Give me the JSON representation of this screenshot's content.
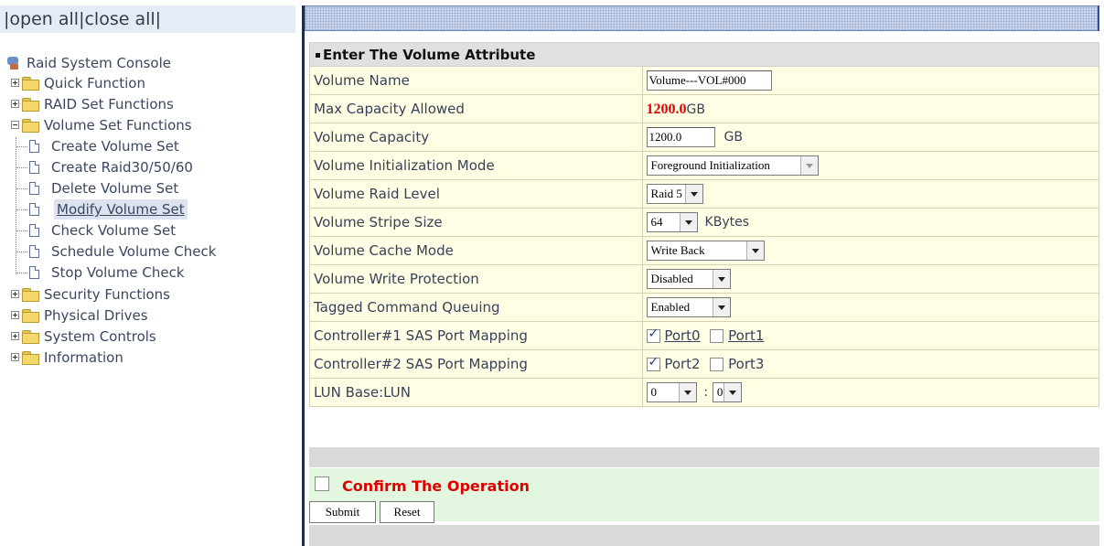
{
  "toolbar": {
    "open_all": "open all",
    "close_all": "close all",
    "sep": "|"
  },
  "tree": {
    "root": "Raid System Console",
    "quick_function": "Quick Function",
    "raid_set_functions": "RAID Set Functions",
    "volume_set_functions": "Volume Set Functions",
    "volume_items": [
      "Create Volume Set",
      "Create Raid30/50/60",
      "Delete Volume Set",
      "Modify Volume Set",
      "Check Volume Set",
      "Schedule Volume Check",
      "Stop Volume Check"
    ],
    "security_functions": "Security Functions",
    "physical_drives": "Physical Drives",
    "system_controls": "System Controls",
    "information": "Information",
    "selected": "Modify Volume Set"
  },
  "form": {
    "header": "Enter The Volume Attribute",
    "labels": {
      "volume_name": "Volume Name",
      "max_capacity": "Max Capacity Allowed",
      "volume_capacity": "Volume Capacity",
      "init_mode": "Volume Initialization Mode",
      "raid_level": "Volume Raid Level",
      "stripe_size": "Volume Stripe Size",
      "cache_mode": "Volume Cache Mode",
      "write_protection": "Volume Write Protection",
      "tcq": "Tagged Command Queuing",
      "ctrl1": "Controller#1 SAS Port Mapping",
      "ctrl2": "Controller#2 SAS Port Mapping",
      "lun": "LUN Base:LUN"
    },
    "values": {
      "volume_name": "Volume---VOL#000",
      "max_capacity": "1200.0",
      "max_capacity_unit": "GB",
      "volume_capacity": "1200.0",
      "volume_capacity_unit": "GB",
      "init_mode": "Foreground Initialization",
      "raid_level": "Raid 5",
      "stripe_size": "64",
      "stripe_unit": "KBytes",
      "cache_mode": "Write Back",
      "write_protection": "Disabled",
      "tcq": "Enabled",
      "port0": "Port0",
      "port1": "Port1",
      "port2": "Port2",
      "port3": "Port3",
      "lun_base": "0",
      "lun_sep": ":",
      "lun": "0"
    },
    "checked": {
      "port0": true,
      "port1": false,
      "port2": true,
      "port3": false,
      "confirm": false
    },
    "confirm_label": "Confirm The Operation",
    "submit": "Submit",
    "reset": "Reset"
  },
  "colors": {
    "accent_red": "#e00000",
    "row_bg": "#fffde3",
    "confirm_bg": "#e3f7e0",
    "divider": "#1d2d4f"
  }
}
